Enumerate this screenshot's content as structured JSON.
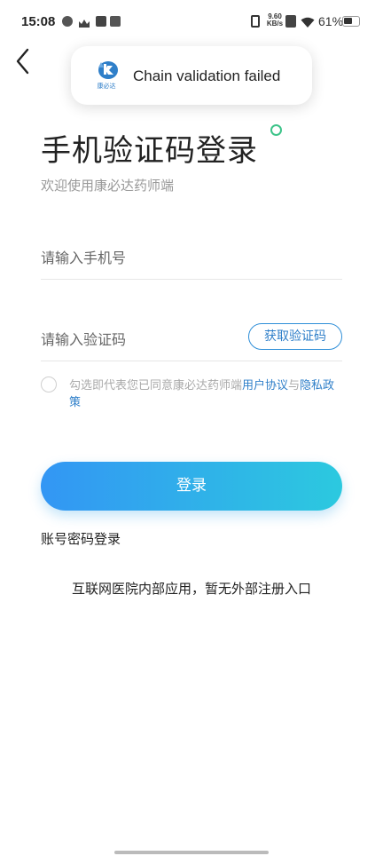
{
  "status_bar": {
    "time": "15:08",
    "net_speed_value": "9.60",
    "net_speed_unit": "KB/s",
    "battery_text": "61%",
    "battery_level": 0.61
  },
  "toast": {
    "logo_text": "康必达",
    "message": "Chain validation failed"
  },
  "page": {
    "title": "手机验证码登录",
    "subtitle": "欢迎使用康必达药师端"
  },
  "form": {
    "phone_placeholder": "请输入手机号",
    "code_placeholder": "请输入验证码",
    "get_code_label": "获取验证码"
  },
  "agreement": {
    "prefix": "勾选即代表您已同意康必达药师端",
    "user_agreement": "用户协议",
    "conjunction": "与",
    "privacy_policy": "隐私政策"
  },
  "actions": {
    "login_label": "登录",
    "alt_login_label": "账号密码登录"
  },
  "notice": "互联网医院内部应用，暂无外部注册入口",
  "colors": {
    "accent_blue": "#2f7fc9",
    "button_gradient_start": "#3396f4",
    "button_gradient_end": "#2cc9df",
    "title_dot": "#3ec48a"
  }
}
